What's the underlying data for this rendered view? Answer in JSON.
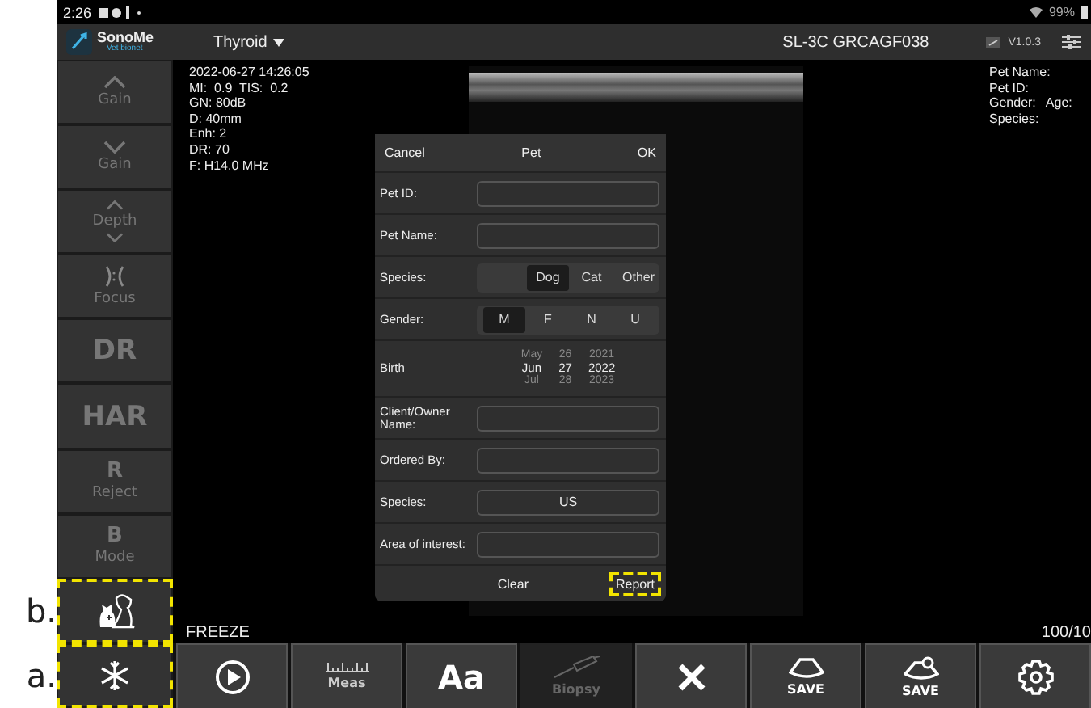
{
  "status_bar": {
    "time": "2:26",
    "battery": "99%"
  },
  "header": {
    "app_name": "SonoMe",
    "app_sub": "Vet bionet",
    "preset": "Thyroid",
    "device": "SL-3C GRCAGF038",
    "version": "V1.0.3"
  },
  "sidebar": [
    {
      "kind": "up",
      "label": "Gain",
      "highlighted": false
    },
    {
      "kind": "down",
      "label": "Gain",
      "highlighted": false
    },
    {
      "kind": "depth",
      "label": "Depth",
      "highlighted": false
    },
    {
      "kind": "focus",
      "label": "Focus",
      "highlighted": false
    },
    {
      "kind": "big",
      "label": "DR",
      "highlighted": false
    },
    {
      "kind": "big",
      "label": "HAR",
      "highlighted": false
    },
    {
      "kind": "letter",
      "letter": "R",
      "label": "Reject",
      "highlighted": false
    },
    {
      "kind": "letter",
      "letter": "B",
      "label": "Mode",
      "highlighted": false
    },
    {
      "kind": "pet",
      "highlighted": true,
      "annotation": "b."
    },
    {
      "kind": "freeze",
      "highlighted": true,
      "annotation": "a."
    }
  ],
  "image_info": [
    "2022-06-27 14:26:05",
    "MI:  0.9  TIS:  0.2",
    "GN: 80dB",
    "D: 40mm",
    "Enh: 2",
    "DR: 70",
    "F: H14.0 MHz"
  ],
  "patient_info": [
    [
      "Pet Name:"
    ],
    [
      "Pet ID:"
    ],
    [
      "Gender:",
      "Age:"
    ],
    [
      "Species:"
    ]
  ],
  "dialog": {
    "cancel": "Cancel",
    "title": "Pet",
    "ok": "OK",
    "rows": [
      {
        "kind": "field",
        "label": "Pet ID:"
      },
      {
        "kind": "field",
        "label": "Pet Name:"
      },
      {
        "kind": "choice",
        "label": "Species:",
        "options": [
          {
            "label": "Dog",
            "selected": true
          },
          {
            "label": "Cat",
            "selected": false
          },
          {
            "label": "Other",
            "selected": false
          }
        ]
      },
      {
        "kind": "choice",
        "label": "Gender:",
        "options": [
          {
            "label": "M",
            "selected": true
          },
          {
            "label": "F",
            "selected": false
          },
          {
            "label": "N",
            "selected": false
          },
          {
            "label": "U",
            "selected": false
          }
        ]
      },
      {
        "kind": "picker",
        "label": "Birth",
        "columns": [
          [
            "May",
            "Jun",
            "Jul"
          ],
          [
            "26",
            "27",
            "28"
          ],
          [
            "2021",
            "2022",
            "2023"
          ]
        ]
      },
      {
        "kind": "field",
        "label": "Client/Owner Name:"
      },
      {
        "kind": "field",
        "label": "Ordered By:"
      },
      {
        "kind": "field",
        "label": "Species:",
        "value": "US"
      },
      {
        "kind": "field",
        "label": "Area of interest:"
      }
    ],
    "clear": "Clear",
    "report": "Report",
    "report_highlighted": true
  },
  "freeze_label": "FREEZE",
  "frame_count": "100/10",
  "toolbar": [
    {
      "kind": "play",
      "disabled": false
    },
    {
      "kind": "meas",
      "label": "Meas",
      "disabled": false
    },
    {
      "kind": "text",
      "label": "Aa",
      "disabled": false
    },
    {
      "kind": "biopsy",
      "label": "Biopsy",
      "disabled": true
    },
    {
      "kind": "close",
      "disabled": false
    },
    {
      "kind": "save-image",
      "label": "SAVE",
      "disabled": false
    },
    {
      "kind": "save-clip",
      "label": "SAVE",
      "disabled": false
    },
    {
      "kind": "settings",
      "disabled": false
    }
  ]
}
